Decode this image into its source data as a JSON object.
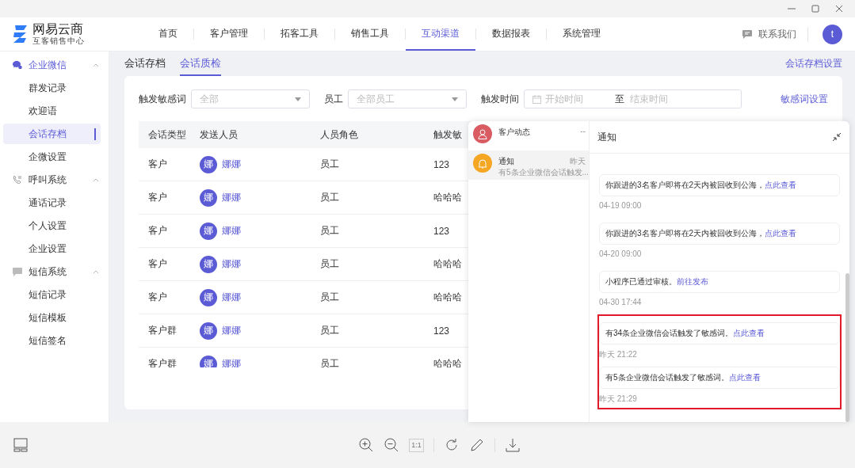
{
  "app": {
    "logo_title": "网易云商",
    "logo_subtitle": "互客销售中心",
    "contact": "联系我们",
    "avatar": "t"
  },
  "nav": [
    {
      "label": "首页",
      "selected": false
    },
    {
      "label": "客户管理",
      "selected": false
    },
    {
      "label": "拓客工具",
      "selected": false
    },
    {
      "label": "销售工具",
      "selected": false
    },
    {
      "label": "互动渠道",
      "selected": true
    },
    {
      "label": "数据报表",
      "selected": false
    },
    {
      "label": "系统管理",
      "selected": false
    }
  ],
  "sidebar": [
    {
      "label": "企业微信",
      "kind": "wechat",
      "expanded": true,
      "active": true,
      "children": [
        {
          "label": "群发记录",
          "selected": false
        },
        {
          "label": "欢迎语",
          "selected": false
        },
        {
          "label": "会话存档",
          "selected": true
        },
        {
          "label": "企微设置",
          "selected": false
        }
      ]
    },
    {
      "label": "呼叫系统",
      "kind": "phone",
      "expanded": true,
      "active": false,
      "children": [
        {
          "label": "通话记录",
          "selected": false
        },
        {
          "label": "个人设置",
          "selected": false
        },
        {
          "label": "企业设置",
          "selected": false
        }
      ]
    },
    {
      "label": "短信系统",
      "kind": "sms",
      "expanded": true,
      "active": false,
      "children": [
        {
          "label": "短信记录",
          "selected": false
        },
        {
          "label": "短信模板",
          "selected": false
        },
        {
          "label": "短信签名",
          "selected": false
        }
      ]
    }
  ],
  "subtabs": [
    {
      "label": "会话存档",
      "selected": false
    },
    {
      "label": "会话质检",
      "selected": true
    }
  ],
  "settings_link": "会话存档设置",
  "filters": {
    "keyword_label": "触发敏感词",
    "keyword_placeholder": "全部",
    "staff_label": "员工",
    "staff_placeholder": "全部员工",
    "time_label": "触发时间",
    "start_placeholder": "开始时间",
    "range_separator": "至",
    "end_placeholder": "结束时间",
    "keyword_settings": "敏感词设置"
  },
  "table": {
    "columns": [
      "会话类型",
      "发送人员",
      "人员角色",
      "触发敏"
    ],
    "rows": [
      {
        "type": "客户",
        "avatar": "娜",
        "sender": "娜娜",
        "role": "员工",
        "keyword": "123"
      },
      {
        "type": "客户",
        "avatar": "娜",
        "sender": "娜娜",
        "role": "员工",
        "keyword": "哈哈哈"
      },
      {
        "type": "客户",
        "avatar": "娜",
        "sender": "娜娜",
        "role": "员工",
        "keyword": "123"
      },
      {
        "type": "客户",
        "avatar": "娜",
        "sender": "娜娜",
        "role": "员工",
        "keyword": "哈哈哈"
      },
      {
        "type": "客户",
        "avatar": "娜",
        "sender": "娜娜",
        "role": "员工",
        "keyword": "哈哈哈"
      },
      {
        "type": "客户群",
        "avatar": "娜",
        "sender": "娜娜",
        "role": "员工",
        "keyword": "123"
      },
      {
        "type": "客户群",
        "avatar": "娜",
        "sender": "娜娜",
        "role": "员工",
        "keyword": "哈哈哈"
      }
    ]
  },
  "notifications": {
    "channels": [
      {
        "kind": "customer",
        "title": "客户动态",
        "time": "--",
        "selected": false
      },
      {
        "kind": "notice",
        "title": "通知",
        "time": "昨天",
        "preview": "有5条企业微信会话触发...",
        "selected": true
      }
    ],
    "title": "通知",
    "messages": [
      {
        "text": "你跟进的3名客户即将在2天内被回收到公海，",
        "link": "点此查看",
        "time": "04-19 09:00",
        "highlighted": false
      },
      {
        "text": "你跟进的3名客户即将在2天内被回收到公海，",
        "link": "点此查看",
        "time": "04-20 09:00",
        "highlighted": false
      },
      {
        "text": "小程序已通过审核。",
        "link": "前往发布",
        "time": "04-30 17:44",
        "highlighted": false
      },
      {
        "text": "有34条企业微信会话触发了敏感词。",
        "link": "点此查看",
        "time": "昨天 21:22",
        "highlighted": true
      },
      {
        "text": "有5条企业微信会话触发了敏感词。",
        "link": "点此查看",
        "time": "昨天 21:29",
        "highlighted": true
      }
    ]
  },
  "viewer": {
    "actual_size": "1:1"
  }
}
